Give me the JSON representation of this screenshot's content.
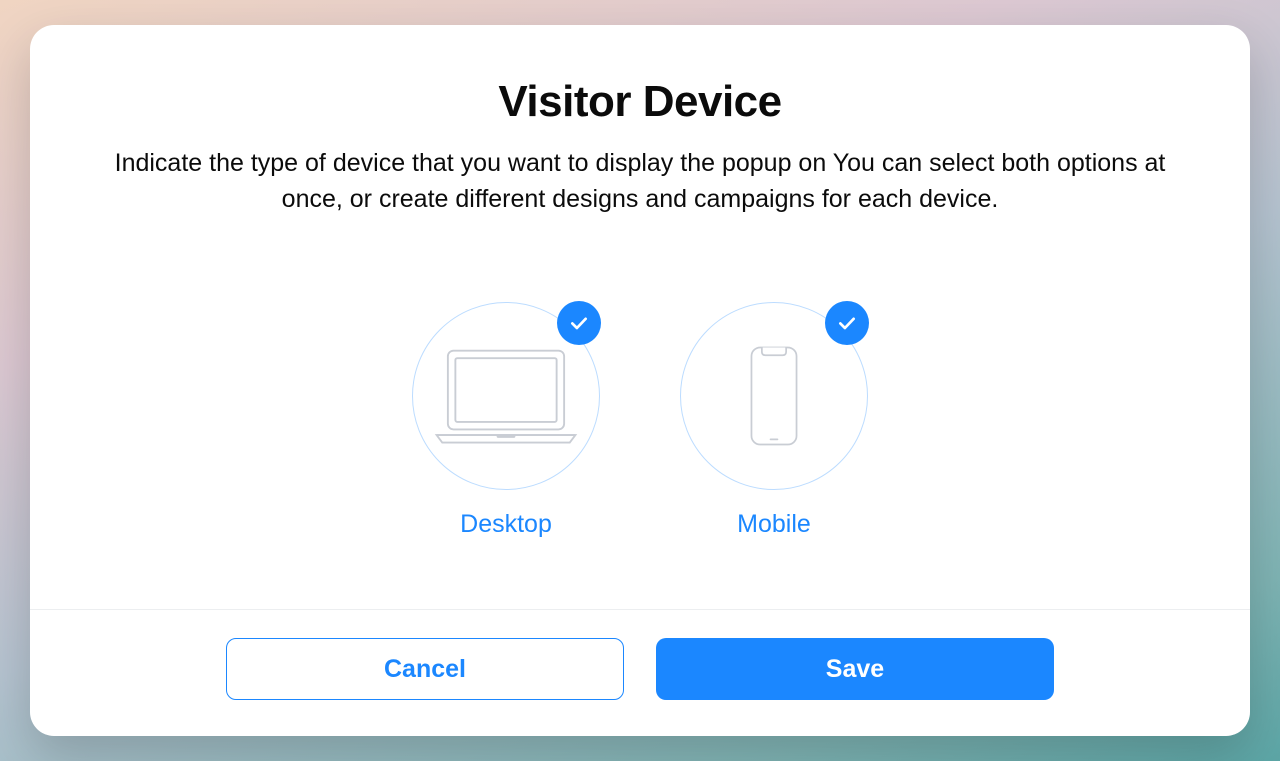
{
  "modal": {
    "title": "Visitor Device",
    "description": "Indicate the type of device that you want to display the popup on You can select both options at once, or create different designs and campaigns for each device."
  },
  "options": {
    "desktop": {
      "label": "Desktop",
      "selected": true
    },
    "mobile": {
      "label": "Mobile",
      "selected": true
    }
  },
  "footer": {
    "cancel_label": "Cancel",
    "save_label": "Save"
  },
  "colors": {
    "accent": "#1b87ff"
  }
}
